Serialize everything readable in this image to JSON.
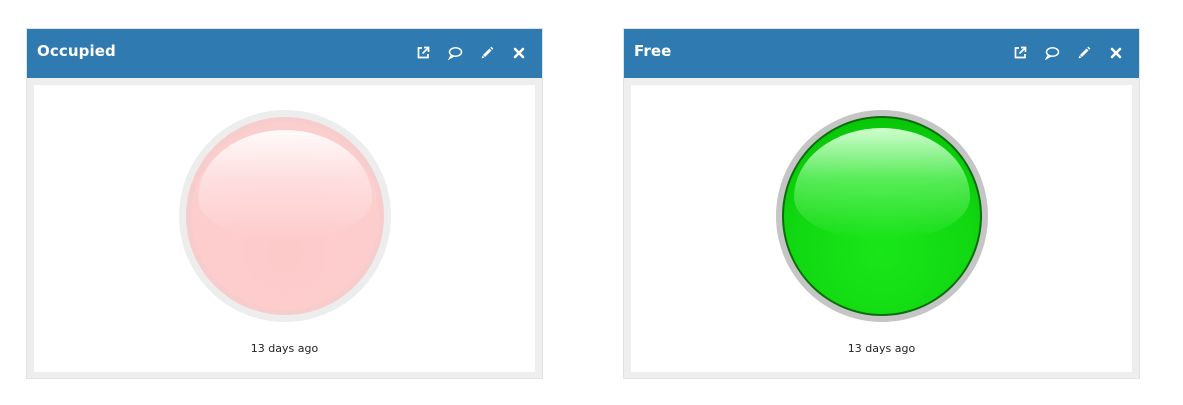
{
  "colors": {
    "header_bg": "#2f7ab0",
    "header_text": "#ffffff",
    "led_occupied": "#fdcaca",
    "led_free": "#11d811"
  },
  "widgets": [
    {
      "title": "Occupied",
      "state_color": "red",
      "led_on": false,
      "timestamp": "13 days ago",
      "icons": [
        "external-link-icon",
        "comment-icon",
        "pencil-icon",
        "close-icon"
      ]
    },
    {
      "title": "Free",
      "state_color": "green",
      "led_on": true,
      "timestamp": "13 days ago",
      "icons": [
        "external-link-icon",
        "comment-icon",
        "pencil-icon",
        "close-icon"
      ]
    }
  ]
}
